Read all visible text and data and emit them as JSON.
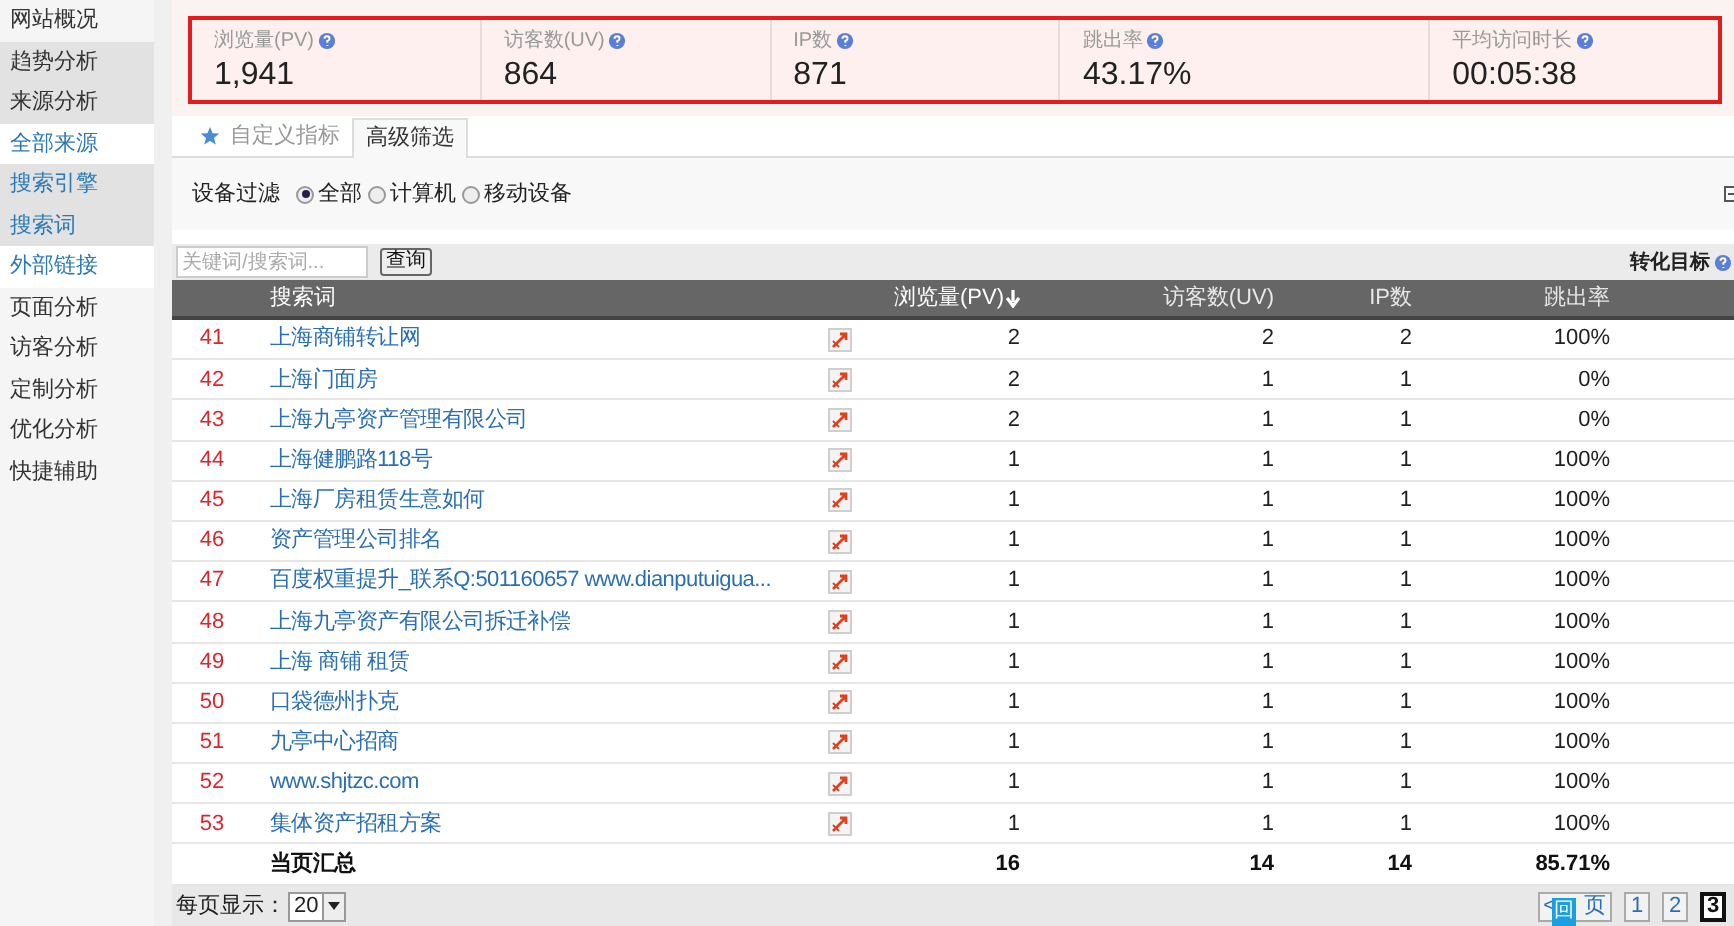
{
  "sidebar": {
    "items": [
      {
        "label": "网站概况",
        "kind": "section"
      },
      {
        "label": "趋势分析",
        "kind": "open-section"
      },
      {
        "label": "来源分析",
        "kind": "open-section"
      },
      {
        "label": "全部来源",
        "kind": "link"
      },
      {
        "label": "搜索引擎",
        "kind": "group"
      },
      {
        "label": "搜索词",
        "kind": "group"
      },
      {
        "label": "外部链接",
        "kind": "link"
      },
      {
        "label": "页面分析",
        "kind": "section"
      },
      {
        "label": "访客分析",
        "kind": "section"
      },
      {
        "label": "定制分析",
        "kind": "section"
      },
      {
        "label": "优化分析",
        "kind": "section"
      },
      {
        "label": "快捷辅助",
        "kind": "section"
      }
    ]
  },
  "stats": [
    {
      "label": "浏览量(PV)",
      "value": "1,941"
    },
    {
      "label": "访客数(UV)",
      "value": "864"
    },
    {
      "label": "IP数",
      "value": "871"
    },
    {
      "label": "跳出率",
      "value": "43.17%"
    },
    {
      "label": "平均访问时长",
      "value": "00:05:38"
    }
  ],
  "tabs": [
    {
      "label": "自定义指标",
      "selected": false
    },
    {
      "label": "高级筛选",
      "selected": true
    }
  ],
  "device_filter": {
    "label": "设备过滤",
    "options": [
      {
        "label": "全部",
        "selected": true
      },
      {
        "label": "计算机",
        "selected": false
      },
      {
        "label": "移动设备",
        "selected": false
      }
    ]
  },
  "search": {
    "placeholder": "关键词/搜索词...",
    "button": "查询",
    "conversion_label": "转化目标"
  },
  "table": {
    "columns": [
      {
        "label": "搜索词",
        "sorted": false
      },
      {
        "label": "浏览量(PV)",
        "sorted": true
      },
      {
        "label": "访客数(UV)",
        "sorted": false
      },
      {
        "label": "IP数",
        "sorted": false
      },
      {
        "label": "跳出率",
        "sorted": false
      }
    ],
    "rows": [
      {
        "rank": "41",
        "keyword": "上海商铺转让网",
        "pv": "2",
        "uv": "2",
        "ip": "2",
        "bounce": "100%"
      },
      {
        "rank": "42",
        "keyword": "上海门面房",
        "pv": "2",
        "uv": "1",
        "ip": "1",
        "bounce": "0%"
      },
      {
        "rank": "43",
        "keyword": "上海九亭资产管理有限公司",
        "pv": "2",
        "uv": "1",
        "ip": "1",
        "bounce": "0%"
      },
      {
        "rank": "44",
        "keyword": "上海健鹏路118号",
        "pv": "1",
        "uv": "1",
        "ip": "1",
        "bounce": "100%"
      },
      {
        "rank": "45",
        "keyword": "上海厂房租赁生意如何",
        "pv": "1",
        "uv": "1",
        "ip": "1",
        "bounce": "100%"
      },
      {
        "rank": "46",
        "keyword": "资产管理公司排名",
        "pv": "1",
        "uv": "1",
        "ip": "1",
        "bounce": "100%"
      },
      {
        "rank": "47",
        "keyword": "百度权重提升_联系Q:501160657 www.dianputuigua...",
        "pv": "1",
        "uv": "1",
        "ip": "1",
        "bounce": "100%"
      },
      {
        "rank": "48",
        "keyword": "上海九亭资产有限公司拆迁补偿",
        "pv": "1",
        "uv": "1",
        "ip": "1",
        "bounce": "100%"
      },
      {
        "rank": "49",
        "keyword": "上海 商铺 租赁",
        "pv": "1",
        "uv": "1",
        "ip": "1",
        "bounce": "100%"
      },
      {
        "rank": "50",
        "keyword": "口袋德州扑克",
        "pv": "1",
        "uv": "1",
        "ip": "1",
        "bounce": "100%"
      },
      {
        "rank": "51",
        "keyword": "九亭中心招商",
        "pv": "1",
        "uv": "1",
        "ip": "1",
        "bounce": "100%"
      },
      {
        "rank": "52",
        "keyword": "www.shjtzc.com",
        "pv": "1",
        "uv": "1",
        "ip": "1",
        "bounce": "100%"
      },
      {
        "rank": "53",
        "keyword": "集体资产招租方案",
        "pv": "1",
        "uv": "1",
        "ip": "1",
        "bounce": "100%"
      }
    ],
    "summary": {
      "label": "当页汇总",
      "pv": "16",
      "uv": "14",
      "ip": "14",
      "bounce": "85.71%"
    }
  },
  "footer": {
    "page_size_label": "每页显示：",
    "page_size": "20",
    "prev_left": "<",
    "prev_right": "页",
    "back_to_top": "回",
    "pages": [
      {
        "label": "1",
        "selected": false
      },
      {
        "label": "2",
        "selected": false
      },
      {
        "label": "3",
        "selected": true
      }
    ]
  }
}
